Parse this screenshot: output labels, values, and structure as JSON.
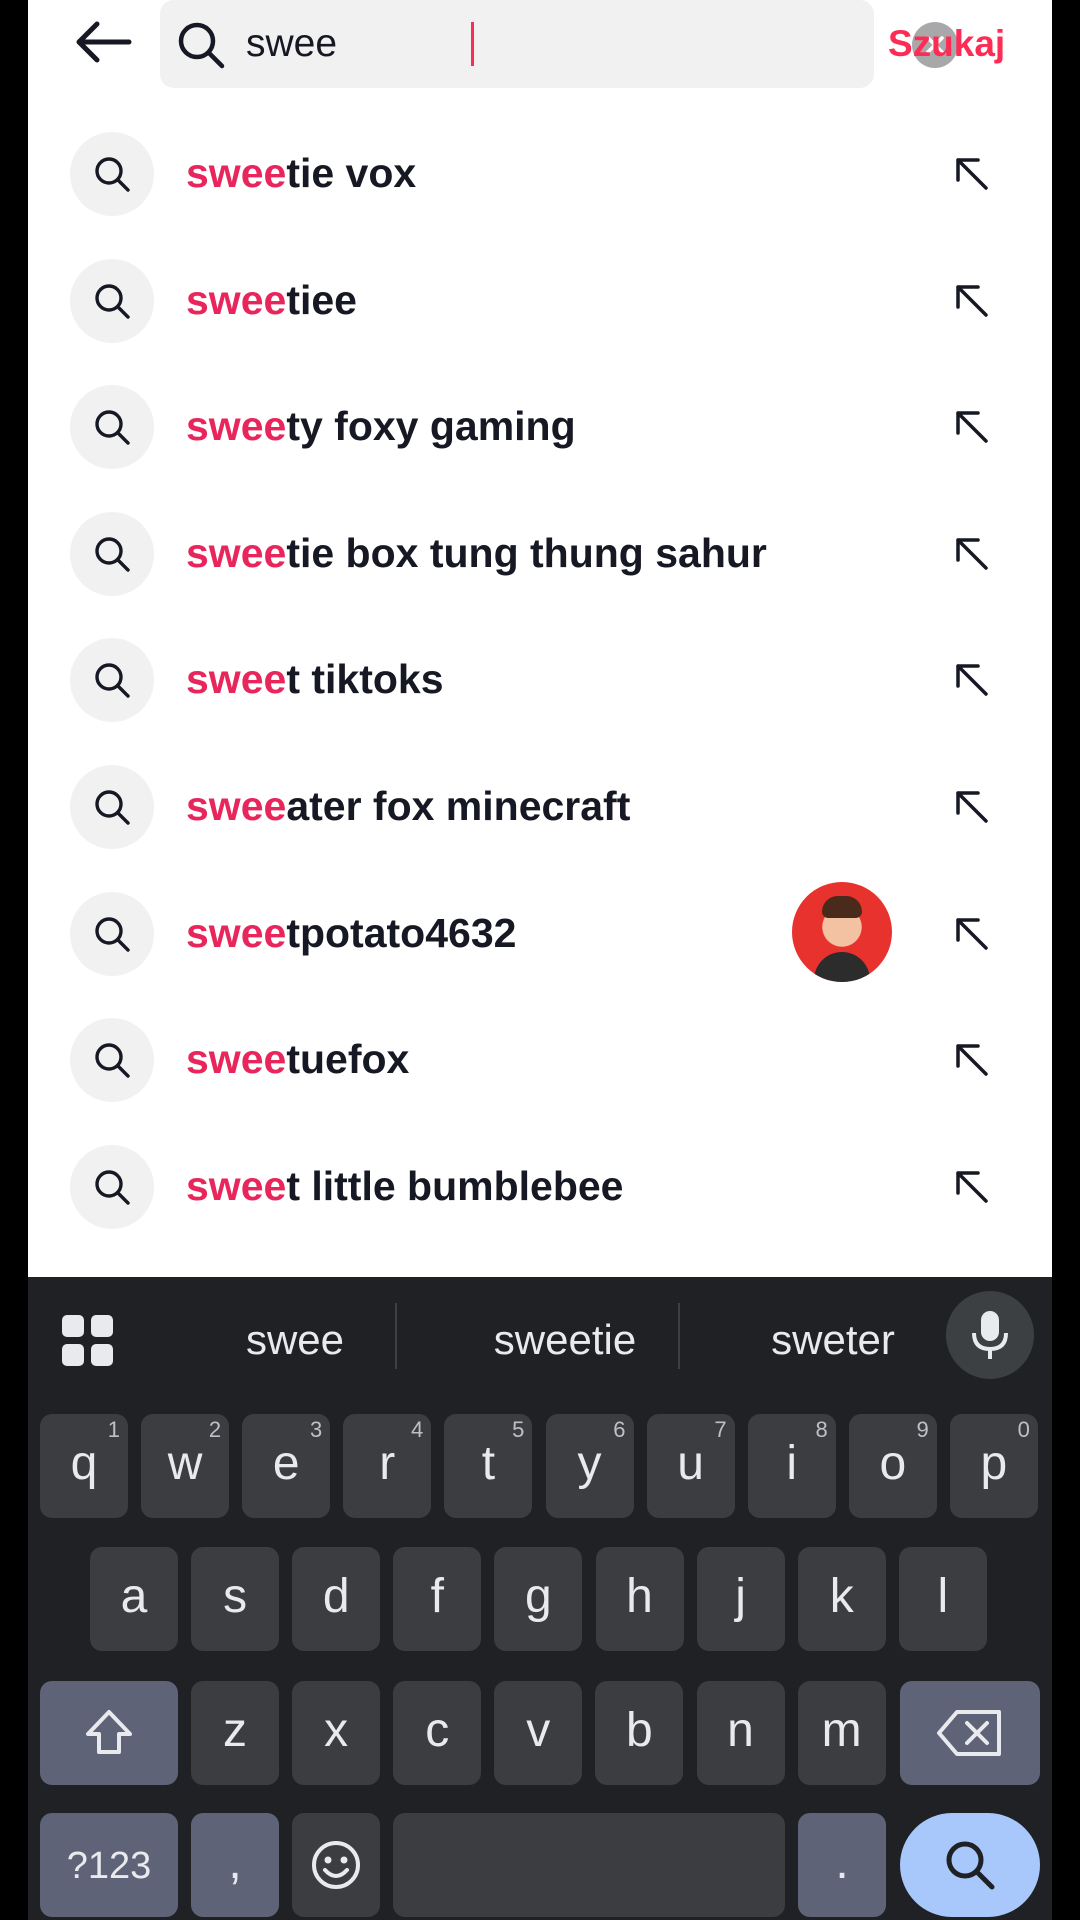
{
  "header": {
    "search_query": "swee",
    "search_button_label": "Szukaj"
  },
  "suggestions": [
    {
      "match": "swee",
      "rest": "tie vox"
    },
    {
      "match": "swee",
      "rest": "tiee"
    },
    {
      "match": "swee",
      "rest": "ty foxy gaming"
    },
    {
      "match": "swee",
      "rest": "tie box tung thung sahur"
    },
    {
      "match": "swee",
      "rest": "t tiktoks"
    },
    {
      "match": "swee",
      "rest": "ater fox minecraft"
    },
    {
      "match": "swee",
      "rest": "tpotato4632",
      "has_avatar": true
    },
    {
      "match": "swee",
      "rest": "tuefox"
    },
    {
      "match": "swee",
      "rest": "t little bumblebee"
    }
  ],
  "keyboard": {
    "word_suggestions": [
      "swee",
      "sweetie",
      "sweter"
    ],
    "row1": [
      {
        "k": "q",
        "h": "1"
      },
      {
        "k": "w",
        "h": "2"
      },
      {
        "k": "e",
        "h": "3"
      },
      {
        "k": "r",
        "h": "4"
      },
      {
        "k": "t",
        "h": "5"
      },
      {
        "k": "y",
        "h": "6"
      },
      {
        "k": "u",
        "h": "7"
      },
      {
        "k": "i",
        "h": "8"
      },
      {
        "k": "o",
        "h": "9"
      },
      {
        "k": "p",
        "h": "0"
      }
    ],
    "row2": [
      "a",
      "s",
      "d",
      "f",
      "g",
      "h",
      "j",
      "k",
      "l"
    ],
    "row3": [
      "z",
      "x",
      "c",
      "v",
      "b",
      "n",
      "m"
    ],
    "symbols_label": "?123",
    "comma_label": ",",
    "period_label": "."
  },
  "colors": {
    "accent": "#fe2c55",
    "highlight": "#e8265c",
    "keyboard_bg": "#202124",
    "key_bg": "#3c3d41"
  }
}
